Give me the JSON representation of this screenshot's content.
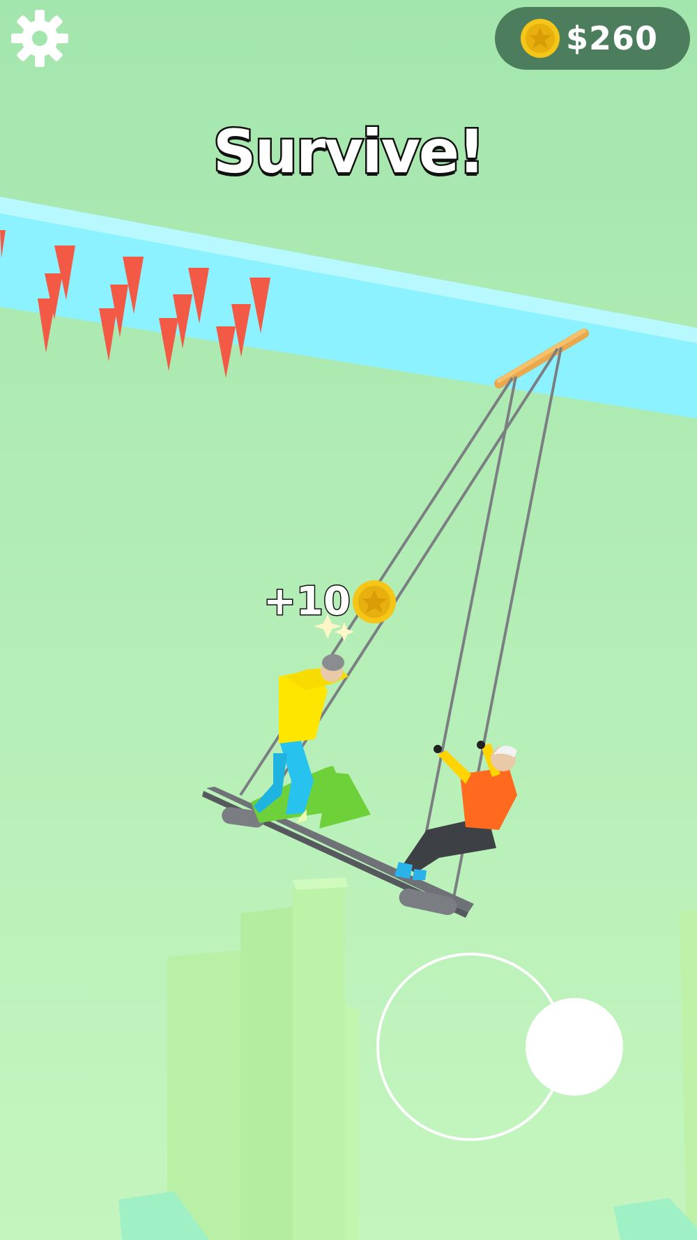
{
  "hud": {
    "coins": "$260",
    "title": "Survive!",
    "reward": "+10"
  },
  "icons": {
    "settings": "gear-icon",
    "coin": "star-coin-icon"
  },
  "colors": {
    "sky": "#a6e8b2",
    "river": "#8ef0ff",
    "spikes": "#f25a46",
    "coin": "#f5c518",
    "hud_pill": "#4c7d5c",
    "yellow_player": "#ffe600",
    "orange_player": "#ff6a1f",
    "arrow": "#6fd13a"
  },
  "joystick": {
    "direction": "right"
  }
}
